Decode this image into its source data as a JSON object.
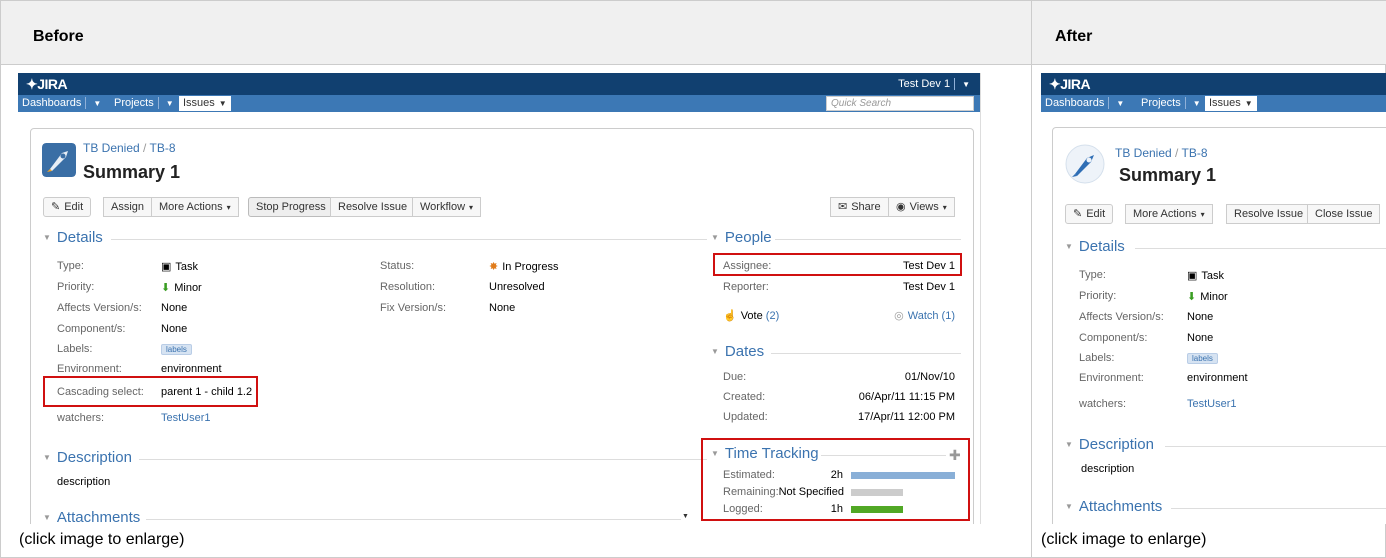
{
  "columns": {
    "before": "Before",
    "after": "After"
  },
  "caption": "(click image to enlarge)",
  "jira": {
    "logo": "✦JIRA",
    "user": "Test Dev 1",
    "nav": {
      "dashboards": "Dashboards",
      "projects": "Projects",
      "issues": "Issues"
    },
    "quick_search": "Quick Search",
    "breadcrumb": {
      "project": "TB Denied",
      "key": "TB-8"
    },
    "summary": "Summary 1",
    "buttons": {
      "edit": "Edit",
      "assign": "Assign",
      "more_actions": "More Actions",
      "stop_progress": "Stop Progress",
      "resolve_issue": "Resolve Issue",
      "workflow": "Workflow",
      "share": "Share",
      "views": "Views",
      "close_issue": "Close Issue"
    },
    "details": {
      "title": "Details",
      "type_label": "Type:",
      "type_value": "Task",
      "priority_label": "Priority:",
      "priority_value": "Minor",
      "affects_label": "Affects Version/s:",
      "affects_value": "None",
      "component_label": "Component/s:",
      "component_value": "None",
      "labels_label": "Labels:",
      "labels_value": "labels",
      "environment_label": "Environment:",
      "environment_value": "environment",
      "cascading_label": "Cascading select:",
      "cascading_value": "parent 1 - child 1.2",
      "watchers_label": "watchers:",
      "watchers_value": "TestUser1",
      "status_label": "Status:",
      "status_value": "In Progress",
      "resolution_label": "Resolution:",
      "resolution_value": "Unresolved",
      "fix_label": "Fix Version/s:",
      "fix_value": "None"
    },
    "people": {
      "title": "People",
      "assignee_label": "Assignee:",
      "assignee_value": "Test Dev 1",
      "reporter_label": "Reporter:",
      "reporter_value": "Test Dev 1",
      "vote": "Vote",
      "vote_count": "(2)",
      "watch": "Watch (1)"
    },
    "dates": {
      "title": "Dates",
      "due_label": "Due:",
      "due_value": "01/Nov/10",
      "created_label": "Created:",
      "created_value": "06/Apr/11 11:15 PM",
      "updated_label": "Updated:",
      "updated_value": "17/Apr/11 12:00 PM"
    },
    "time_tracking": {
      "title": "Time Tracking",
      "estimated_label": "Estimated:",
      "estimated_value": "2h",
      "remaining_label": "Remaining:",
      "remaining_value": "Not Specified",
      "logged_label": "Logged:",
      "logged_value": "1h",
      "estimated_fraction": 1.0,
      "remaining_fraction": 0.5,
      "logged_fraction": 0.5
    },
    "description": {
      "title": "Description",
      "text": "description"
    },
    "attachments": {
      "title": "Attachments"
    }
  },
  "colors": {
    "topbar": "#114070",
    "navbar": "#3c78b5",
    "link": "#3b73af",
    "highlight": "#d01010",
    "estimated_bar": "#89afd7",
    "remaining_bar": "#cccccc",
    "logged_bar": "#51a825"
  }
}
